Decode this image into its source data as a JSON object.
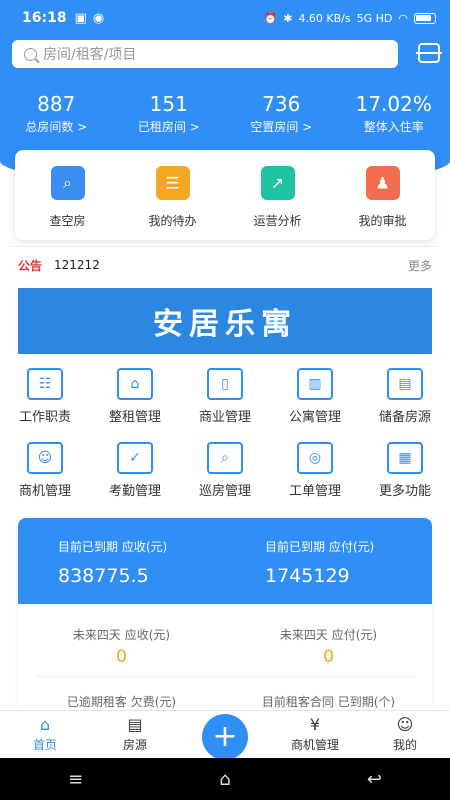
{
  "status_bar": {
    "time": "16:18",
    "speed": "4.60 KB/s",
    "network": "5G HD"
  },
  "search": {
    "placeholder": "房间/租客/项目"
  },
  "stats": [
    {
      "value": "887",
      "label": "总房间数 >"
    },
    {
      "value": "151",
      "label": "已租房间 >"
    },
    {
      "value": "736",
      "label": "空置房间 >"
    },
    {
      "value": "17.02%",
      "label": "整体入住率"
    }
  ],
  "quick": [
    {
      "label": "查空房",
      "icon": "search-room-icon"
    },
    {
      "label": "我的待办",
      "icon": "todo-icon"
    },
    {
      "label": "运营分析",
      "icon": "chart-icon"
    },
    {
      "label": "我的审批",
      "icon": "approval-icon"
    }
  ],
  "notice": {
    "tag": "公告",
    "text": "121212",
    "more": "更多"
  },
  "banner": {
    "text": "安居乐寓"
  },
  "grid": [
    {
      "label": "工作职责",
      "icon": "duty-icon"
    },
    {
      "label": "整租管理",
      "icon": "house-icon"
    },
    {
      "label": "商业管理",
      "icon": "door-icon"
    },
    {
      "label": "公寓管理",
      "icon": "building-icon"
    },
    {
      "label": "储备房源",
      "icon": "folder-icon"
    },
    {
      "label": "商机管理",
      "icon": "person-icon"
    },
    {
      "label": "考勤管理",
      "icon": "calendar-icon"
    },
    {
      "label": "巡房管理",
      "icon": "patrol-icon"
    },
    {
      "label": "工单管理",
      "icon": "workorder-icon"
    },
    {
      "label": "更多功能",
      "icon": "more-icon"
    }
  ],
  "finance": {
    "due_receivable_label": "目前已到期 应收(元)",
    "due_receivable_value": "838775.5",
    "due_payable_label": "目前已到期 应付(元)",
    "due_payable_value": "1745129",
    "next4_receivable_label": "未来四天 应收(元)",
    "next4_receivable_value": "0",
    "next4_payable_label": "未来四天 应付(元)",
    "next4_payable_value": "0",
    "overdue_label": "已逾期租客 欠费(元)",
    "expired_label": "目前租客合同 已到期(个)"
  },
  "tabs": [
    {
      "label": "首页",
      "icon": "home-icon"
    },
    {
      "label": "房源",
      "icon": "listing-icon"
    },
    {
      "label": "商机管理",
      "icon": "business-icon"
    },
    {
      "label": "我的",
      "icon": "profile-icon"
    }
  ],
  "colors": {
    "primary": "#2f8ff5",
    "accent": "#f5a623",
    "notice": "#e53935"
  }
}
